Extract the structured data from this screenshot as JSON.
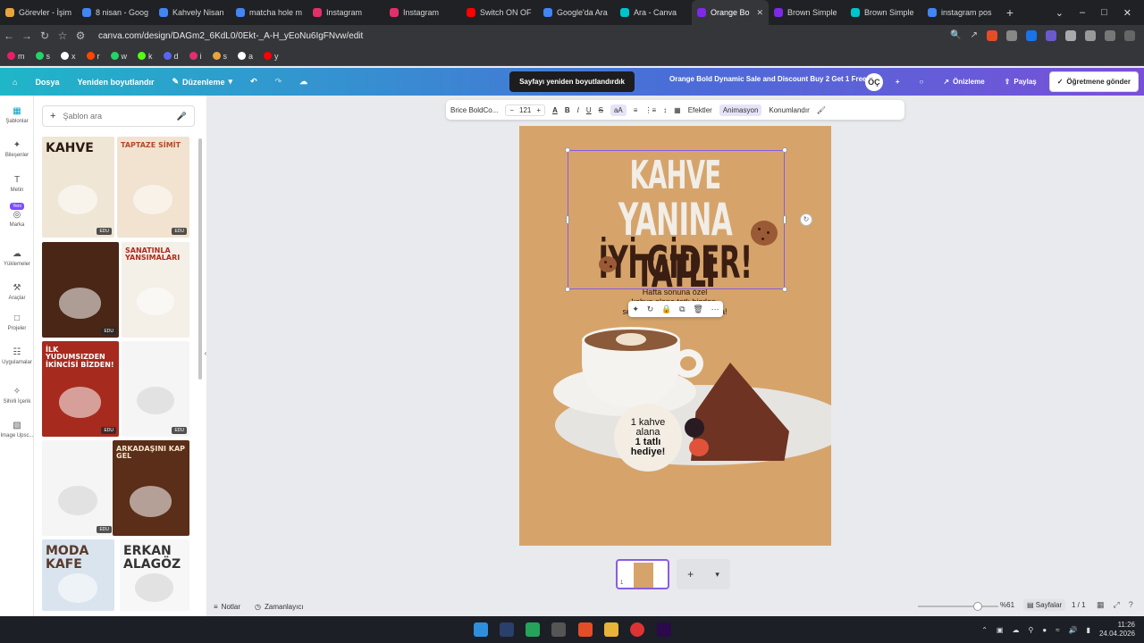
{
  "browser": {
    "tabs": [
      {
        "label": "Görevler - İşim",
        "color": "#e8a33d"
      },
      {
        "label": "8 nisan - Goog",
        "color": "#4285f4"
      },
      {
        "label": "Kahvely Nisan",
        "color": "#4285f4"
      },
      {
        "label": "matcha hole m",
        "color": "#4285f4"
      },
      {
        "label": "Instagram",
        "color": "#e1306c"
      },
      {
        "label": "Instagram",
        "color": "#e1306c"
      },
      {
        "label": "Switch ON OF",
        "color": "#ff0000"
      },
      {
        "label": "Google'da Ara",
        "color": "#4285f4"
      },
      {
        "label": "Ara - Canva",
        "color": "#00c4cc"
      },
      {
        "label": "Orange Bo",
        "color": "#7d2ae8",
        "active": true
      },
      {
        "label": "Brown Simple",
        "color": "#7d2ae8"
      },
      {
        "label": "Brown Simple",
        "color": "#00c4cc"
      },
      {
        "label": "instagram pos",
        "color": "#4285f4"
      }
    ],
    "url": "canva.com/design/DAGm2_6KdL0/0Ekt-_A-H_yEoNu6IgFNvw/edit",
    "bookmarks": [
      {
        "label": "m",
        "color": "#e91e63"
      },
      {
        "label": "s",
        "color": "#25d366"
      },
      {
        "label": "x",
        "color": "#ffffff"
      },
      {
        "label": "r",
        "color": "#ff4500"
      },
      {
        "label": "w",
        "color": "#25d366"
      },
      {
        "label": "k",
        "color": "#53fc18"
      },
      {
        "label": "d",
        "color": "#5865f2"
      },
      {
        "label": "i",
        "color": "#e1306c"
      },
      {
        "label": "s",
        "color": "#e8a33d"
      },
      {
        "label": "a",
        "color": "#ffffff"
      },
      {
        "label": "y",
        "color": "#ff0000"
      }
    ]
  },
  "canva_top": {
    "home_icon": "home-icon",
    "file": "Dosya",
    "resize": "Yeniden boyutlandır",
    "edit": "Düzenleme",
    "toast": "Sayfayı yeniden boyutlandırdık",
    "design_title": "Orange Bold Dynamic Sale and Discount Buy 2 Get 1 Free In...",
    "avatar": "ÖÇ",
    "preview": "Önizleme",
    "share": "Paylaş",
    "submit": "Öğretmene gönder"
  },
  "rail": [
    {
      "label": "Şablonlar",
      "icon": "template-icon",
      "active": true
    },
    {
      "label": "Bileşenler",
      "icon": "elements-icon"
    },
    {
      "label": "Metin",
      "icon": "text-icon"
    },
    {
      "label": "Marka",
      "icon": "brand-icon",
      "badge": "Yeni"
    },
    {
      "label": "Yüklemeler",
      "icon": "upload-icon"
    },
    {
      "label": "Araçlar",
      "icon": "tools-icon"
    },
    {
      "label": "Projeler",
      "icon": "folder-icon"
    },
    {
      "label": "Uygulamalar",
      "icon": "apps-icon"
    },
    {
      "label": "Sihirli İçerik",
      "icon": "magic-icon"
    },
    {
      "label": "Image Upsc...",
      "icon": "image-upscale-icon"
    }
  ],
  "panel": {
    "search_placeholder": "Şablon ara",
    "templates": [
      {
        "title": "KAHVE",
        "bg": "#efe6d6",
        "fg": "#2a1a10",
        "edu": "EDU"
      },
      {
        "title": "TAPTAZE SİMİT",
        "bg": "#f1e3cf",
        "fg": "#b5482a",
        "edu": "EDU"
      },
      {
        "title": "",
        "bg": "#4a2616",
        "fg": "#f1d9b0",
        "edu": "EDU"
      },
      {
        "title": "SANATINLA YANSIMALARI",
        "bg": "#f4efe7",
        "fg": "#b02a1a",
        "edu": ""
      },
      {
        "title": "İLK YUDUMSIZDEN İKİNCİSİ BİZDEN!",
        "bg": "#a72a1f",
        "fg": "#ffffff",
        "edu": "EDU"
      },
      {
        "title": "",
        "bg": "#f5f5f5",
        "fg": "#333333",
        "edu": "EDU"
      },
      {
        "title": "",
        "bg": "#f5f5f5",
        "fg": "#333333",
        "edu": "EDU"
      },
      {
        "title": "ARKADAŞINI KAP GEL",
        "bg": "#5a2e18",
        "fg": "#f5e3c9",
        "edu": ""
      },
      {
        "title": "MODA KAFE",
        "bg": "#d9e4ee",
        "fg": "#5a3a2a",
        "edu": ""
      },
      {
        "title": "ERKAN ALAGÖZ",
        "bg": "#f7f7f7",
        "fg": "#333333",
        "edu": ""
      }
    ]
  },
  "editbar": {
    "font": "Brice BoldCo...",
    "font_size": "121",
    "effects": "Efektler",
    "animation": "Animasyon",
    "position": "Konumlandır"
  },
  "design": {
    "line1": "KAHVE",
    "line2a": "YANINA",
    "line2b": "TATLI",
    "line3": "İYİ GİDER!",
    "sub_line1": "Hafta sonuna özel",
    "sub_line2": "kahve alana tatlı bizden,",
    "sub_line3": "seçe seçe keyfini çıkar, dava!",
    "badge_line1": "1 kahve",
    "badge_line2": "alana",
    "badge_line3": "1 tatlı",
    "badge_line4": "hediye!",
    "bg_color": "#d6a46b",
    "accent_color": "#3b1e12"
  },
  "pages": {
    "thumb_number": "1"
  },
  "bottom": {
    "notes": "Notlar",
    "timer": "Zamanlayıcı",
    "zoom_level": 0.61,
    "zoom": "%61",
    "pages": "Sayfalar",
    "page_count": "1 / 1"
  },
  "taskbar": {
    "time": "11:26",
    "date": "24.04.2026"
  }
}
